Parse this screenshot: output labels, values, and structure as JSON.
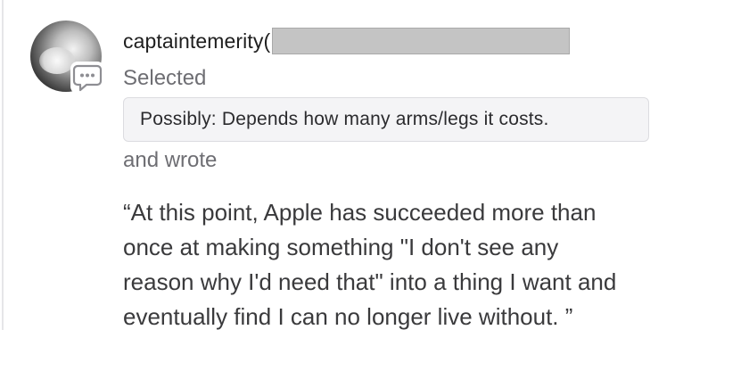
{
  "comment": {
    "username": "captaintemerity(",
    "username_redacted": true,
    "action_selected": "Selected",
    "selected_option": "Possibly: Depends how many arms/legs it costs.",
    "action_wrote": "and wrote",
    "quote_lines": [
      "“At this point, Apple has succeeded more than",
      "once at making something \"I don't see any",
      "reason why I'd need that\" into a thing I want and",
      "eventually find I can no longer live without. ”"
    ]
  },
  "icons": {
    "avatar": "user-avatar-photo",
    "badge": "speech-bubble-icon"
  },
  "colors": {
    "text_primary": "#1f1f1f",
    "text_secondary": "#6e6e73",
    "chip_bg": "#f4f4f6",
    "chip_border": "#dcdce0",
    "redaction": "#c4c4c4"
  }
}
